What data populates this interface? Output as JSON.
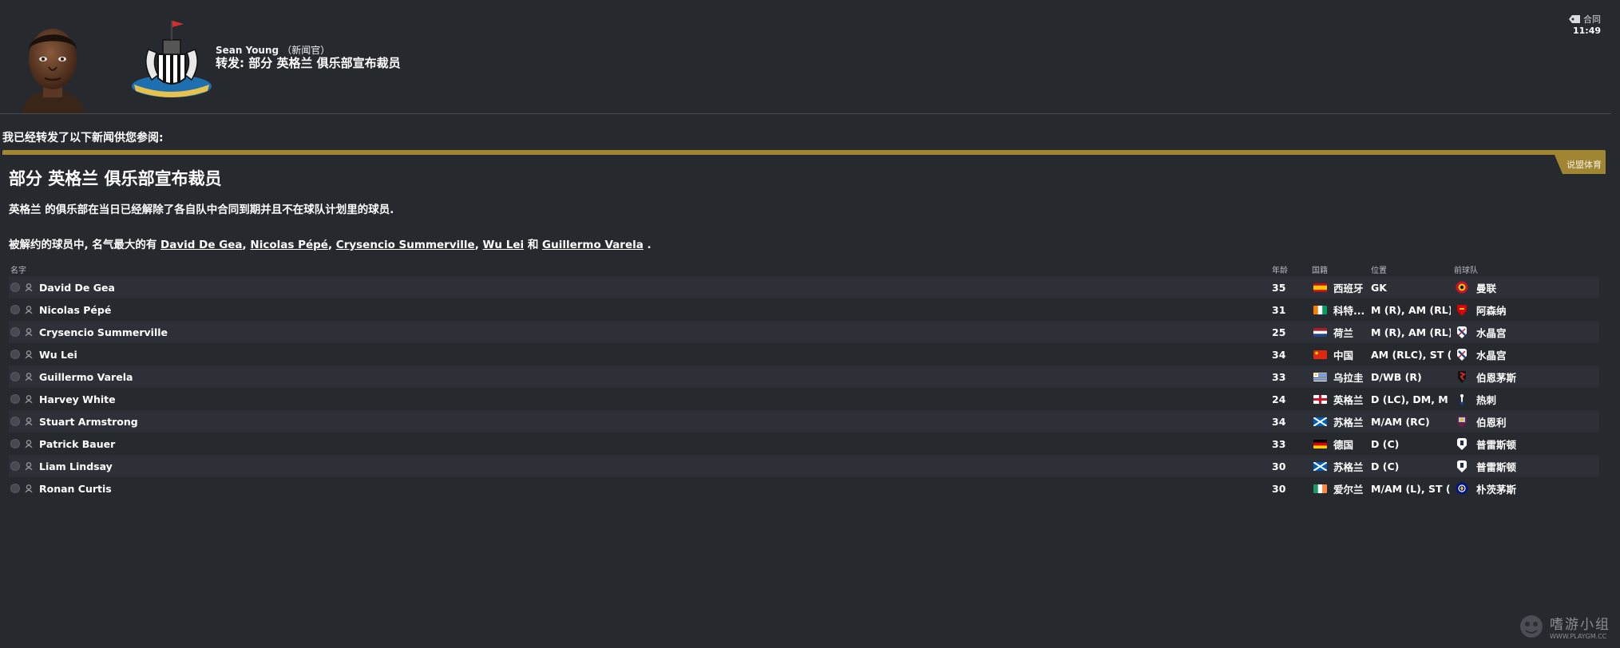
{
  "header": {
    "sender_name": "Sean Young",
    "sender_role": "（新闻官）",
    "subject": "转发: 部分 英格兰 俱乐部宣布裁员",
    "reply_label": "合同",
    "time": "11:49"
  },
  "intro": "我已经转发了以下新闻供您参阅:",
  "news": {
    "tag": "说盟体育",
    "headline": "部分 英格兰 俱乐部宣布裁员",
    "body1": "英格兰 的俱乐部在当日已经解除了各自队中合同到期并且不在球队计划里的球员.",
    "body2_prefix": "被解约的球员中, 名气最大的有 ",
    "body2_names": [
      "David De Gea",
      "Nicolas Pépé",
      "Crysencio Summerville",
      "Wu Lei"
    ],
    "body2_and": "和",
    "body2_last": "Guillermo Varela",
    "body2_suffix": "."
  },
  "table": {
    "headers": {
      "name": "名字",
      "age": "年龄",
      "nationality": "国籍",
      "position": "位置",
      "club": "前球队"
    },
    "rows": [
      {
        "name": "David De Gea",
        "age": "35",
        "nat": "西班牙",
        "pos": "GK",
        "club": "曼联"
      },
      {
        "name": "Nicolas Pépé",
        "age": "31",
        "nat": "科特...",
        "pos": "M (R), AM (RL),...",
        "club": "阿森纳"
      },
      {
        "name": "Crysencio Summerville",
        "age": "25",
        "nat": "荷兰",
        "pos": "M (R), AM (RL)",
        "club": "水晶宫"
      },
      {
        "name": "Wu Lei",
        "age": "34",
        "nat": "中国",
        "pos": "AM (RLC), ST (C)",
        "club": "水晶宫"
      },
      {
        "name": "Guillermo Varela",
        "age": "33",
        "nat": "乌拉圭",
        "pos": "D/WB (R)",
        "club": "伯恩茅斯"
      },
      {
        "name": "Harvey White",
        "age": "24",
        "nat": "英格兰",
        "pos": "D (LC), DM, M (...",
        "club": "热刺"
      },
      {
        "name": "Stuart Armstrong",
        "age": "34",
        "nat": "苏格兰",
        "pos": "M/AM (RC)",
        "club": "伯恩利"
      },
      {
        "name": "Patrick Bauer",
        "age": "33",
        "nat": "德国",
        "pos": "D (C)",
        "club": "普雷斯顿"
      },
      {
        "name": "Liam Lindsay",
        "age": "30",
        "nat": "苏格兰",
        "pos": "D (C)",
        "club": "普雷斯顿"
      },
      {
        "name": "Ronan Curtis",
        "age": "30",
        "nat": "爱尔兰",
        "pos": "M/AM (L), ST (C)",
        "club": "朴茨茅斯"
      }
    ]
  },
  "watermark": {
    "title": "嗜游小组",
    "url": "WWW.PLAYGM.CC"
  },
  "colors": {
    "background": "#262a2f",
    "accent_gold": "#a08533",
    "row_alt": "#2d3137"
  }
}
